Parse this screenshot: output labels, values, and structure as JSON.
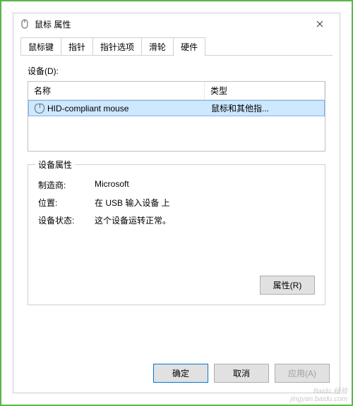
{
  "window": {
    "title": "鼠标 属性"
  },
  "tabs": [
    {
      "label": "鼠标键"
    },
    {
      "label": "指针"
    },
    {
      "label": "指针选项"
    },
    {
      "label": "滑轮"
    },
    {
      "label": "硬件"
    }
  ],
  "active_tab": "硬件",
  "devices_label": "设备(D):",
  "list": {
    "columns": {
      "name": "名称",
      "type": "类型"
    },
    "rows": [
      {
        "name": "HID-compliant mouse",
        "type": "鼠标和其他指..."
      }
    ]
  },
  "properties_group": {
    "title": "设备属性",
    "manufacturer_label": "制造商:",
    "manufacturer_value": "Microsoft",
    "location_label": "位置:",
    "location_value": "在 USB 输入设备 上",
    "status_label": "设备状态:",
    "status_value": "这个设备运转正常。",
    "properties_button": "属性(R)"
  },
  "buttons": {
    "ok": "确定",
    "cancel": "取消",
    "apply": "应用(A)"
  },
  "watermark": {
    "line1": "Baidu 经验",
    "line2": "jingyan.baidu.com"
  }
}
